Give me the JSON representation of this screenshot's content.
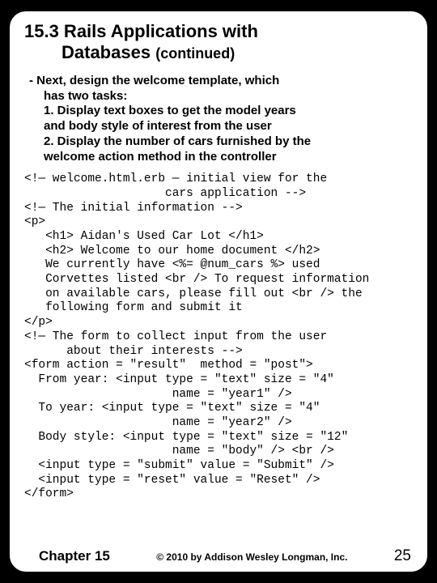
{
  "title": {
    "line1": "15.3 Rails Applications with",
    "line2": "Databases",
    "cont": "(continued)"
  },
  "bullets": {
    "intro": "- Next, design the welcome template, which",
    "intro2": "has two tasks:",
    "item1a": "1. Display text boxes to get the model years",
    "item1b": "and body style of interest from the user",
    "item2a": "2. Display the number of cars furnished by the",
    "item2b": "welcome action method in the controller"
  },
  "code": "<!— welcome.html.erb — initial view for the\n                    cars application -->\n<!— The initial information -->\n<p>\n   <h1> Aidan's Used Car Lot </h1>\n   <h2> Welcome to our home document </h2>\n   We currently have <%= @num_cars %> used\n   Corvettes listed <br /> To request information\n   on available cars, please fill out <br /> the\n   following form and submit it\n</p>\n<!— The form to collect input from the user\n      about their interests -->\n<form action = \"result\"  method = \"post\">\n  From year: <input type = \"text\" size = \"4\"\n                     name = \"year1\" />\n  To year: <input type = \"text\" size = \"4\"\n                     name = \"year2\" />\n  Body style: <input type = \"text\" size = \"12\"\n                     name = \"body\" /> <br />\n  <input type = \"submit\" value = \"Submit\" />\n  <input type = \"reset\" value = \"Reset\" />\n</form>",
  "footer": {
    "chapter": "Chapter 15",
    "copyright": "© 2010 by Addison Wesley Longman, Inc.",
    "page": "25"
  }
}
